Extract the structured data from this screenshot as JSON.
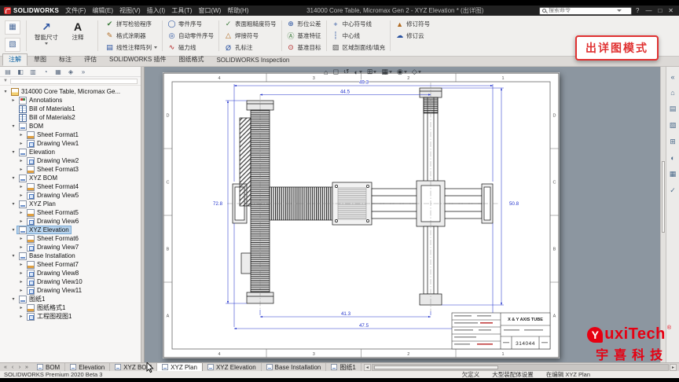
{
  "titlebar": {
    "app_name": "SOLIDWORKS",
    "menus": [
      "文件(F)",
      "编辑(E)",
      "视图(V)",
      "插入(I)",
      "工具(T)",
      "窗口(W)",
      "帮助(H)"
    ],
    "document_title": "314000 Core Table, Micromax Gen 2 - XYZ Elevation * (出详图)",
    "search_placeholder": "搜索命令",
    "window_controls": [
      {
        "name": "help-button",
        "glyph": "?"
      },
      {
        "name": "minimize-button",
        "glyph": "—"
      },
      {
        "name": "restore-button",
        "glyph": "□"
      },
      {
        "name": "close-button",
        "glyph": "✕"
      }
    ]
  },
  "ribbon": {
    "tool_stack": [
      {
        "name": "model-items-button",
        "glyph": "▦",
        "color": "#4a6a9a"
      },
      {
        "name": "drawing-properties-button",
        "glyph": "▧",
        "color": "#4a6a9a"
      }
    ],
    "big_buttons": [
      {
        "name": "smart-dimension-button",
        "label": "智能尺寸",
        "glyph": "↗",
        "color": "#2a52a0",
        "dropdown": true
      },
      {
        "name": "note-button",
        "label": "注释",
        "glyph": "A",
        "color": "#1a1a1a",
        "dropdown": false
      }
    ],
    "columns": [
      {
        "buttons": [
          {
            "name": "spell-checker-button",
            "label": "拼写检验程序",
            "glyph": "✔",
            "color": "#3a7a3a"
          },
          {
            "name": "format-painter-button",
            "label": "格式涂刷器",
            "glyph": "✎",
            "color": "#b06a20"
          },
          {
            "name": "linear-note-pattern-button",
            "label": "线性注释阵列",
            "glyph": "▤",
            "color": "#2a52a0",
            "dropdown": true
          }
        ]
      },
      {
        "buttons": [
          {
            "name": "balloon-button",
            "label": "零件序号",
            "glyph": "◯",
            "color": "#2a52a0"
          },
          {
            "name": "auto-balloon-button",
            "label": "自动零件序号",
            "glyph": "◎",
            "color": "#2a52a0"
          },
          {
            "name": "magnetic-line-button",
            "label": "磁力线",
            "glyph": "∿",
            "color": "#b02020"
          }
        ]
      },
      {
        "buttons": [
          {
            "name": "surface-finish-button",
            "label": "表面粗糙度符号",
            "glyph": "✓",
            "color": "#3a7a3a"
          },
          {
            "name": "weld-symbol-button",
            "label": "焊接符号",
            "glyph": "△",
            "color": "#b06a20"
          },
          {
            "name": "hole-callout-button",
            "label": "孔标注",
            "glyph": "Ø",
            "color": "#2a52a0"
          }
        ]
      },
      {
        "buttons": [
          {
            "name": "geometric-tolerance-button",
            "label": "形位公差",
            "glyph": "⊕",
            "color": "#2a52a0"
          },
          {
            "name": "datum-feature-button",
            "label": "基准特征",
            "glyph": "Ⓐ",
            "color": "#3a7a3a"
          },
          {
            "name": "datum-target-button",
            "label": "基准目标",
            "glyph": "⊙",
            "color": "#b02020"
          }
        ]
      },
      {
        "buttons": [
          {
            "name": "center-mark-button",
            "label": "中心符号线",
            "glyph": "+",
            "color": "#2a52a0"
          },
          {
            "name": "centerline-button",
            "label": "中心线",
            "glyph": "┆",
            "color": "#2a52a0"
          },
          {
            "name": "area-hatch-button",
            "label": "区域剖面线/填充",
            "glyph": "▨",
            "color": "#555555"
          }
        ]
      },
      {
        "buttons": [
          {
            "name": "revision-symbol-button",
            "label": "修订符号",
            "glyph": "▲",
            "color": "#b06a20"
          },
          {
            "name": "revision-cloud-button",
            "label": "修订云",
            "glyph": "☁",
            "color": "#2a52a0"
          }
        ]
      }
    ]
  },
  "command_tabs": [
    {
      "label": "注解",
      "active": true
    },
    {
      "label": "草图",
      "active": false
    },
    {
      "label": "标注",
      "active": false
    },
    {
      "label": "评估",
      "active": false
    },
    {
      "label": "SOLIDWORKS 插件",
      "active": false
    },
    {
      "label": "图纸格式",
      "active": false
    },
    {
      "label": "SOLIDWORKS Inspection",
      "active": false
    }
  ],
  "mode_badge": "出详图模式",
  "left_panel": {
    "tabs": [
      {
        "name": "feature-manager-tab",
        "glyph": "▤"
      },
      {
        "name": "property-manager-tab",
        "glyph": "◧"
      },
      {
        "name": "configuration-manager-tab",
        "glyph": "▥"
      },
      {
        "name": "dimxpert-manager-tab",
        "glyph": "◔"
      },
      {
        "name": "display-manager-tab",
        "glyph": "▦"
      },
      {
        "name": "inspection-manager-tab",
        "glyph": "◈"
      }
    ],
    "overflow_glyph": "»",
    "filter_glyph": "▼",
    "tree": [
      {
        "label": "314000 Core Table, Micromax Ge...",
        "level": 0,
        "icon": "root",
        "arrow": "▾"
      },
      {
        "label": "Annotations",
        "level": 1,
        "icon": "ann",
        "arrow": "▸"
      },
      {
        "label": "Bill of Materials1",
        "level": 1,
        "icon": "bom",
        "arrow": ""
      },
      {
        "label": "Bill of Materials2",
        "level": 1,
        "icon": "bom",
        "arrow": ""
      },
      {
        "label": "BOM",
        "level": 1,
        "icon": "sheet",
        "arrow": "▾"
      },
      {
        "label": "Sheet Format1",
        "level": 2,
        "icon": "fmt",
        "arrow": "▸"
      },
      {
        "label": "Drawing View1",
        "level": 2,
        "icon": "view",
        "arrow": "▸"
      },
      {
        "label": "Elevation",
        "level": 1,
        "icon": "sheet",
        "arrow": "▾"
      },
      {
        "label": "Drawing View2",
        "level": 2,
        "icon": "view",
        "arrow": "▸"
      },
      {
        "label": "Sheet Format3",
        "level": 2,
        "icon": "fmt",
        "arrow": "▸"
      },
      {
        "label": "XYZ BOM",
        "level": 1,
        "icon": "sheet",
        "arrow": "▾"
      },
      {
        "label": "Sheet Format4",
        "level": 2,
        "icon": "fmt",
        "arrow": "▸"
      },
      {
        "label": "Drawing View5",
        "level": 2,
        "icon": "view",
        "arrow": "▸"
      },
      {
        "label": "XYZ Plan",
        "level": 1,
        "icon": "sheet",
        "arrow": "▾"
      },
      {
        "label": "Sheet Format5",
        "level": 2,
        "icon": "fmt",
        "arrow": "▸"
      },
      {
        "label": "Drawing View6",
        "level": 2,
        "icon": "view",
        "arrow": "▸"
      },
      {
        "label": "XYZ Elevation",
        "level": 1,
        "icon": "sheet",
        "arrow": "▾",
        "selected": true
      },
      {
        "label": "Sheet Format6",
        "level": 2,
        "icon": "fmt",
        "arrow": "▸"
      },
      {
        "label": "Drawing View7",
        "level": 2,
        "icon": "view",
        "arrow": "▸"
      },
      {
        "label": "Base Installation",
        "level": 1,
        "icon": "sheet",
        "arrow": "▾"
      },
      {
        "label": "Sheet Format7",
        "level": 2,
        "icon": "fmt",
        "arrow": "▸"
      },
      {
        "label": "Drawing View8",
        "level": 2,
        "icon": "view",
        "arrow": "▸"
      },
      {
        "label": "Drawing View10",
        "level": 2,
        "icon": "view",
        "arrow": "▸"
      },
      {
        "label": "Drawing View11",
        "level": 2,
        "icon": "view",
        "arrow": "▸"
      },
      {
        "label": "图纸1",
        "level": 1,
        "icon": "sheet",
        "arrow": "▾"
      },
      {
        "label": "图纸格式1",
        "level": 2,
        "icon": "fmt",
        "arrow": "▸"
      },
      {
        "label": "工程图视图1",
        "level": 2,
        "icon": "view",
        "arrow": "▸"
      }
    ]
  },
  "heads_up": [
    {
      "name": "zoom-fit-icon",
      "glyph": "⌂",
      "caret": false
    },
    {
      "name": "zoom-area-icon",
      "glyph": "◻",
      "caret": false
    },
    {
      "name": "previous-view-icon",
      "glyph": "↺",
      "caret": false
    },
    {
      "name": "section-view-icon",
      "glyph": "◐",
      "caret": true
    },
    {
      "name": "view-orientation-icon",
      "glyph": "⊞",
      "caret": true
    },
    {
      "name": "display-style-icon",
      "glyph": "▦",
      "caret": true
    },
    {
      "name": "hide-show-icon",
      "glyph": "◉",
      "caret": true
    },
    {
      "name": "view-settings-icon",
      "glyph": "◇",
      "caret": true
    }
  ],
  "task_pane": [
    {
      "name": "collapse-taskpane-icon",
      "glyph": "«"
    },
    {
      "name": "resources-icon",
      "glyph": "⌂"
    },
    {
      "name": "design-library-icon",
      "glyph": "▤"
    },
    {
      "name": "file-explorer-icon",
      "glyph": "▧"
    },
    {
      "name": "view-palette-icon",
      "glyph": "⊞"
    },
    {
      "name": "appearances-icon",
      "glyph": "◐"
    },
    {
      "name": "custom-properties-icon",
      "glyph": "▦"
    },
    {
      "name": "inspection-icon",
      "glyph": "✓"
    }
  ],
  "drawing": {
    "zone_columns": [
      "4",
      "3",
      "2",
      "1"
    ],
    "zone_rows": [
      "D",
      "C",
      "B",
      "A"
    ],
    "dimensions": {
      "top_width": "49.3",
      "top_inner": "44.5",
      "left_height": "72.8",
      "right_height": "50.8",
      "bottom_inner": "41.3",
      "bottom_width": "47.5"
    },
    "title_block": {
      "title": "X & Y AXIS TUBE",
      "drawing_number": "314044"
    }
  },
  "sheet_tabs": {
    "nav": [
      "«",
      "‹",
      "›",
      "»"
    ],
    "tabs": [
      {
        "label": "BOM",
        "active": false
      },
      {
        "label": "Elevation",
        "active": false
      },
      {
        "label": "XYZ BOM",
        "active": false
      },
      {
        "label": "XYZ Plan",
        "active": true
      },
      {
        "label": "XYZ Elevation",
        "active": false
      },
      {
        "label": "Base Installation",
        "active": false
      },
      {
        "label": "图纸1",
        "active": false
      }
    ],
    "scroll_left": "◂",
    "scroll_right": "▸"
  },
  "statusbar": {
    "left": "SOLIDWORKS Premium 2020 Beta 3",
    "right": [
      "欠定义",
      "大型装配体设置",
      "在编辑 XYZ Plan"
    ]
  },
  "watermark": {
    "initial": "Y",
    "latin": "uxiTech",
    "reg": "®",
    "chinese": "宇喜科技"
  }
}
